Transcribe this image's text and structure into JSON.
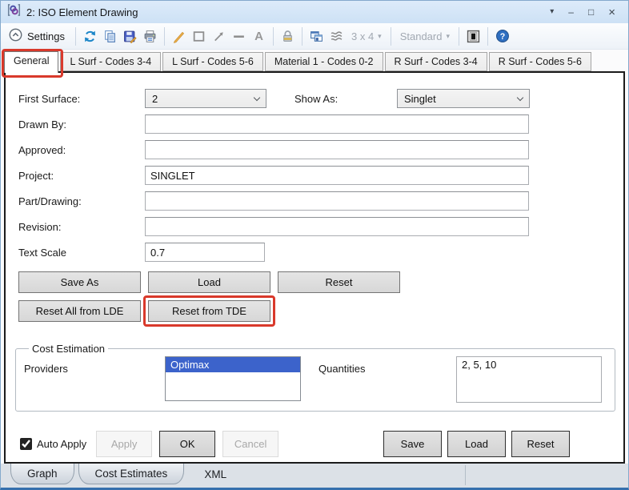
{
  "window": {
    "title": "2: ISO Element Drawing",
    "controls": {
      "menu": "▾",
      "minimize": "–",
      "maximize": "□",
      "close": "×"
    }
  },
  "toolbar": {
    "settings_label": "Settings",
    "grid_size_label": "3 x 4",
    "standard_label": "Standard",
    "caret": "▾",
    "text_tool_label": "A",
    "icons": [
      "app-icon",
      "settings-chevron-icon",
      "refresh-icon",
      "copy-icon",
      "save-icon",
      "print-icon",
      "pencil-icon",
      "rectangle-icon",
      "arrow-icon",
      "line-icon",
      "text-icon",
      "lock-icon",
      "cascade-windows-icon",
      "layers-icon",
      "invert-display-icon",
      "help-icon"
    ]
  },
  "tabs": [
    {
      "label": "General",
      "active": true
    },
    {
      "label": "L Surf - Codes 3-4"
    },
    {
      "label": "L Surf - Codes 5-6"
    },
    {
      "label": "Material 1 - Codes 0-2"
    },
    {
      "label": "R Surf - Codes 3-4"
    },
    {
      "label": "R Surf - Codes 5-6"
    }
  ],
  "form": {
    "first_surface": {
      "label": "First Surface:",
      "value": "2"
    },
    "show_as": {
      "label": "Show As:",
      "value": "Singlet"
    },
    "drawn_by": {
      "label": "Drawn By:",
      "value": ""
    },
    "approved": {
      "label": "Approved:",
      "value": ""
    },
    "project": {
      "label": "Project:",
      "value": "SINGLET"
    },
    "part_drawing": {
      "label": "Part/Drawing:",
      "value": ""
    },
    "revision": {
      "label": "Revision:",
      "value": ""
    },
    "text_scale": {
      "label": "Text Scale",
      "value": "0.7"
    }
  },
  "actions": {
    "save_as": "Save As",
    "load": "Load",
    "reset": "Reset",
    "reset_all_lde": "Reset All from LDE",
    "reset_from_tde": "Reset from TDE"
  },
  "cost_estimation": {
    "title": "Cost Estimation",
    "providers_label": "Providers",
    "providers": [
      {
        "name": "Optimax",
        "selected": true
      }
    ],
    "quantities_label": "Quantities",
    "quantities_value": "2, 5, 10"
  },
  "footer": {
    "auto_apply_label": "Auto Apply",
    "auto_apply_checked": "checked",
    "apply": "Apply",
    "ok": "OK",
    "cancel": "Cancel",
    "save": "Save",
    "load": "Load",
    "reset": "Reset"
  },
  "bottom_tabs": [
    {
      "label": "Graph"
    },
    {
      "label": "Cost Estimates"
    },
    {
      "label": "XML",
      "active": true
    }
  ],
  "annotations": {
    "highlight_color": "#d9392b",
    "highlighted_elements": [
      "General tab",
      "Reset from TDE button"
    ]
  }
}
